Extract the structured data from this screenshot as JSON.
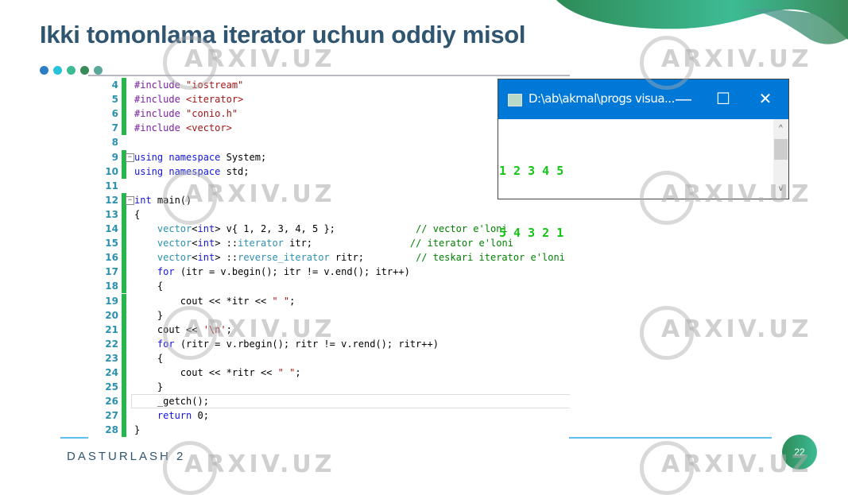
{
  "slide": {
    "title": "Ikki tomonlama iterator uchun oddiy misol",
    "footer": "DASTURLASH 2",
    "page_number": "22",
    "dot_colors": [
      "#2c7fc6",
      "#27c3d8",
      "#3dbb94",
      "#3a8a5a",
      "#5aa89a"
    ],
    "accent_green": "#22b84a",
    "watermark": "ARXIV.UZ"
  },
  "editor": {
    "lines": [
      {
        "n": "4",
        "tokens": [
          [
            "pp",
            "#include "
          ],
          [
            "str",
            "\"iostream\""
          ]
        ]
      },
      {
        "n": "5",
        "tokens": [
          [
            "pp",
            "#include "
          ],
          [
            "str",
            "<iterator>"
          ]
        ]
      },
      {
        "n": "6",
        "tokens": [
          [
            "pp",
            "#include "
          ],
          [
            "str",
            "\"conio.h\""
          ]
        ]
      },
      {
        "n": "7",
        "tokens": [
          [
            "pp",
            "#include "
          ],
          [
            "str",
            "<vector>"
          ]
        ]
      },
      {
        "n": "8",
        "tokens": []
      },
      {
        "n": "9",
        "tokens": [
          [
            "kw",
            "using namespace "
          ],
          [
            "",
            "System;"
          ]
        ],
        "fold": true
      },
      {
        "n": "10",
        "tokens": [
          [
            "kw",
            "using namespace "
          ],
          [
            "",
            "std;"
          ]
        ]
      },
      {
        "n": "11",
        "tokens": []
      },
      {
        "n": "12",
        "tokens": [
          [
            "kw",
            "int "
          ],
          [
            "",
            "main()"
          ]
        ],
        "fold": true
      },
      {
        "n": "13",
        "tokens": [
          [
            "",
            "{"
          ]
        ]
      },
      {
        "n": "14",
        "tokens": [
          [
            "",
            "    "
          ],
          [
            "typ",
            "vector"
          ],
          [
            "",
            "<"
          ],
          [
            "kw",
            "int"
          ],
          [
            "",
            "> v{ 1, 2, 3, 4, 5 };              "
          ],
          [
            "cmt",
            "// vector e'loni"
          ]
        ]
      },
      {
        "n": "15",
        "tokens": [
          [
            "",
            "    "
          ],
          [
            "typ",
            "vector"
          ],
          [
            "",
            "<"
          ],
          [
            "kw",
            "int"
          ],
          [
            "",
            "> ::"
          ],
          [
            "typ",
            "iterator"
          ],
          [
            "",
            " itr;                 "
          ],
          [
            "cmt",
            "// iterator e'loni"
          ]
        ]
      },
      {
        "n": "16",
        "tokens": [
          [
            "",
            "    "
          ],
          [
            "typ",
            "vector"
          ],
          [
            "",
            "<"
          ],
          [
            "kw",
            "int"
          ],
          [
            "",
            "> ::"
          ],
          [
            "typ",
            "reverse_iterator"
          ],
          [
            "",
            "",
            " ritr;         "
          ],
          [
            "cmt",
            "// teskari iterator e'loni"
          ]
        ]
      },
      {
        "n": "17",
        "tokens": [
          [
            "",
            "    "
          ],
          [
            "kw",
            "for"
          ],
          [
            "",
            " (itr = v.begin(); itr != v.end(); itr++)"
          ]
        ]
      },
      {
        "n": "18",
        "tokens": [
          [
            "",
            "    {"
          ]
        ]
      },
      {
        "n": "19",
        "tokens": [
          [
            "",
            "        cout << *itr << "
          ],
          [
            "str",
            "\" \""
          ],
          [
            "",
            ";"
          ]
        ]
      },
      {
        "n": "20",
        "tokens": [
          [
            "",
            "    }"
          ]
        ]
      },
      {
        "n": "21",
        "tokens": [
          [
            "",
            "    cout << "
          ],
          [
            "str",
            "'\\n'"
          ],
          [
            "",
            ";"
          ]
        ]
      },
      {
        "n": "22",
        "tokens": [
          [
            "",
            "    "
          ],
          [
            "kw",
            "for"
          ],
          [
            "",
            " (ritr = v.rbegin(); ritr != v.rend(); ritr++)"
          ]
        ]
      },
      {
        "n": "23",
        "tokens": [
          [
            "",
            "    {"
          ]
        ]
      },
      {
        "n": "24",
        "tokens": [
          [
            "",
            "        cout << *ritr << "
          ],
          [
            "str",
            "\" \""
          ],
          [
            "",
            ";"
          ]
        ]
      },
      {
        "n": "25",
        "tokens": [
          [
            "",
            "    }"
          ]
        ]
      },
      {
        "n": "26",
        "tokens": [
          [
            "",
            "    _getch();"
          ]
        ],
        "current": true
      },
      {
        "n": "27",
        "tokens": [
          [
            "",
            "    "
          ],
          [
            "kw",
            "return"
          ],
          [
            "",
            " 0;"
          ]
        ]
      },
      {
        "n": "28",
        "tokens": [
          [
            "",
            "}"
          ]
        ]
      }
    ]
  },
  "console": {
    "title": "D:\\ab\\akmal\\progs visua...",
    "minimize_glyph": "—",
    "maximize_glyph": "☐",
    "close_glyph": "✕",
    "output_lines": [
      "1 2 3 4 5",
      "5 4 3 2 1"
    ],
    "scroll_up": "^",
    "scroll_down": "v"
  }
}
